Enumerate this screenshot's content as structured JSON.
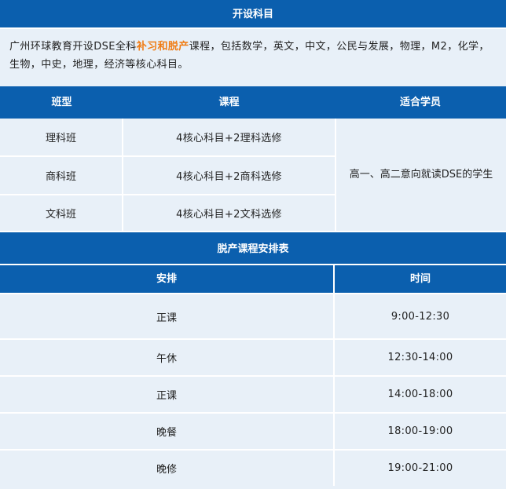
{
  "section1": {
    "title": "开设科目"
  },
  "intro": {
    "text_before": "广州环球教育开设DSE全科",
    "highlight": "补习和脱产",
    "text_after": "课程，包括数学，英文，中文，公民与发展，物理，M2，化学，生物，中史，地理，经济等核心科目。",
    "highlight_color": "#f07c14"
  },
  "table1": {
    "headers": [
      "班型",
      "课程",
      "适合学员"
    ],
    "rows": [
      {
        "class": "理科班",
        "course": "4核心科目+2理科选修"
      },
      {
        "class": "商科班",
        "course": "4核心科目+2商科选修"
      },
      {
        "class": "文科班",
        "course": "4核心科目+2文科选修"
      }
    ],
    "suitable": "高一、高二意向就读DSE的学生"
  },
  "section2": {
    "title": "脱产课程安排表"
  },
  "table2": {
    "headers": [
      "安排",
      "时间"
    ],
    "rows": [
      {
        "item": "正课",
        "time": "9:00-12:30"
      },
      {
        "item": "午休",
        "time": "12:30-14:00"
      },
      {
        "item": "正课",
        "time": "14:00-18:00"
      },
      {
        "item": "晚餐",
        "time": "18:00-19:00"
      },
      {
        "item": "晚修",
        "time": "19:00-21:00"
      }
    ]
  },
  "colors": {
    "header_blue": "#0b5fae",
    "cell_background": "#e8f0f8",
    "divider": "#ffffff"
  }
}
